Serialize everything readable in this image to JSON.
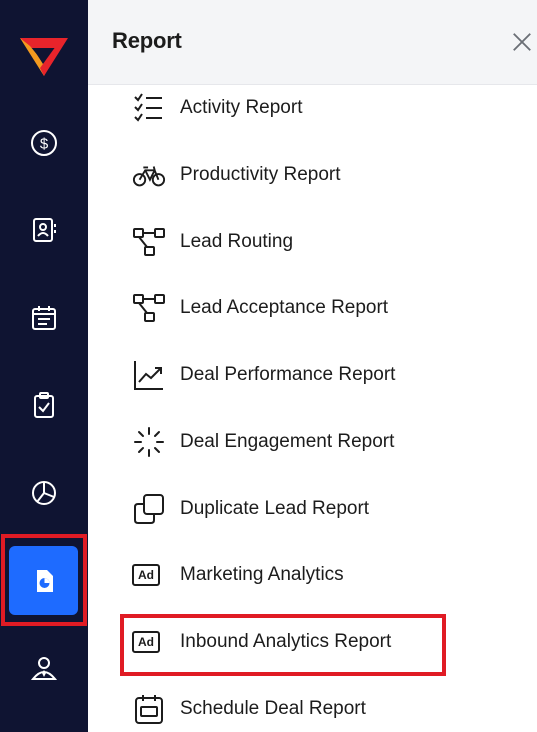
{
  "app": {
    "logo": "velocify-logo"
  },
  "rail": {
    "items": [
      {
        "icon": "dollar-icon"
      },
      {
        "icon": "contacts-icon"
      },
      {
        "icon": "calendar-icon"
      },
      {
        "icon": "clipboard-check-icon"
      },
      {
        "icon": "pie-chart-icon"
      },
      {
        "icon": "report-icon",
        "active": true
      },
      {
        "icon": "user-tie-icon"
      }
    ]
  },
  "panel": {
    "title": "Report",
    "close_icon": "close-icon",
    "items": [
      {
        "label": "Activity Report",
        "icon": "checklist-icon"
      },
      {
        "label": "Productivity Report",
        "icon": "bicycle-icon"
      },
      {
        "label": "Lead Routing",
        "icon": "flow-icon"
      },
      {
        "label": "Lead Acceptance Report",
        "icon": "flow-icon"
      },
      {
        "label": "Deal Performance Report",
        "icon": "trend-chart-icon"
      },
      {
        "label": "Deal Engagement Report",
        "icon": "loading-icon"
      },
      {
        "label": "Duplicate Lead Report",
        "icon": "duplicate-icon"
      },
      {
        "label": "Marketing Analytics",
        "icon": "ad-icon",
        "badge": "Ad"
      },
      {
        "label": "Inbound Analytics Report",
        "icon": "ad-icon",
        "badge": "Ad",
        "highlighted": true
      },
      {
        "label": "Schedule Deal Report",
        "icon": "calendar-schedule-icon"
      }
    ]
  },
  "colors": {
    "rail_bg": "#0f1432",
    "active_bg": "#1e6bff",
    "highlight": "#e01b24",
    "logo_red": "#e8242b",
    "logo_orange": "#f39a1f"
  }
}
